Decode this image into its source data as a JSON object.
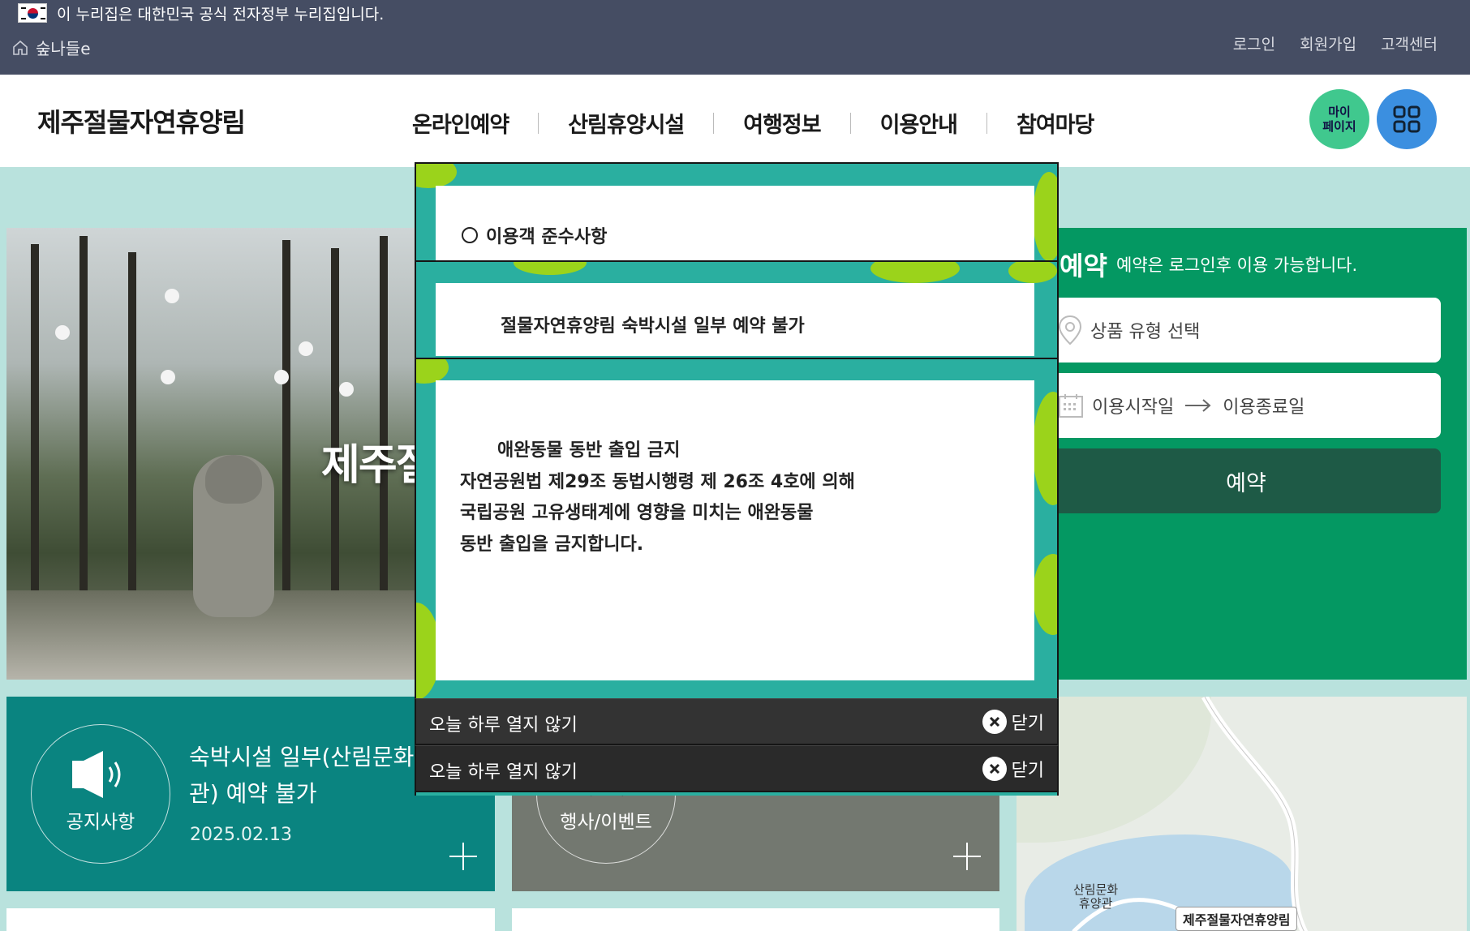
{
  "gov_banner": {
    "text": "이 누리집은 대한민국 공식 전자정부 누리집입니다."
  },
  "site": {
    "home_label": "숲나들e"
  },
  "utility": {
    "links": [
      "로그인",
      "회원가입",
      "고객센터"
    ]
  },
  "header": {
    "logo": "제주절물자연휴양림",
    "nav": [
      "온라인예약",
      "산림휴양시설",
      "여행정보",
      "이용안내",
      "참여마당"
    ],
    "mypage_line1": "마이",
    "mypage_line2": "페이지"
  },
  "hero": {
    "title": "제주절"
  },
  "reserve": {
    "title": "예약",
    "note": "예약은 로그인후 이용 가능합니다.",
    "product_placeholder": "상품 유형 선택",
    "start_label": "이용시작일",
    "end_label": "이용종료일",
    "button": "예약"
  },
  "notice": {
    "label": "공지사항",
    "headline": "숙박시설 일부(산림문화휴양관) 예약 불가",
    "date": "2025.02.13"
  },
  "event": {
    "label": "행사/이벤트"
  },
  "map": {
    "label_building": "산림문화\n휴양관",
    "label_place": "제주절물자연휴양림"
  },
  "popups": {
    "p1_title": "이용객 준수사항",
    "p2_title": "절물자연휴양림 숙박시설 일부 예약 불가",
    "p3_text": "      애완동물 동반 출입 금지\n자연공원법 제29조 동법시행령 제 26조 4호에 의해\n국립공원 고유생태계에 영향을 미치는 애완동물\n동반 출입을 금지합니다.",
    "dismiss_today": "오늘 하루 열지 않기",
    "close": "닫기"
  },
  "colors": {
    "topbar": "#454d63",
    "reserve_green": "#049862",
    "notice_teal": "#0a8480",
    "popup_teal": "#2aafa0",
    "leaf_green": "#9bd31b"
  }
}
